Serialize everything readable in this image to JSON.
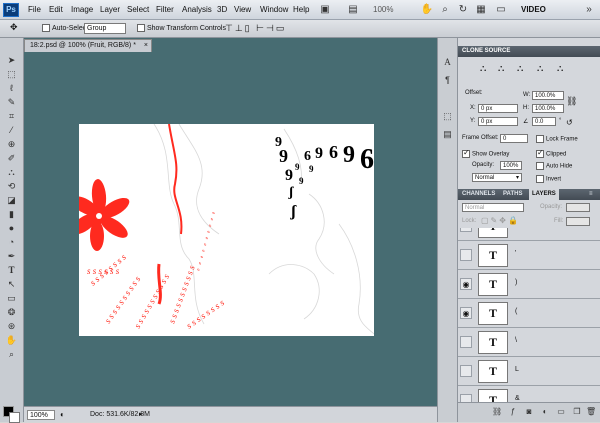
{
  "app": {
    "logo": "Ps"
  },
  "menu": [
    "File",
    "Edit",
    "Image",
    "Layer",
    "Select",
    "Filter",
    "Analysis",
    "3D",
    "View",
    "Window",
    "Help"
  ],
  "menubar_right": {
    "zoom": "100%",
    "workspace": "VIDEO"
  },
  "options": {
    "auto_select_label": "Auto-Select:",
    "auto_select_value": "Group",
    "show_transform_label": "Show Transform Controls"
  },
  "document": {
    "tab_title": "18:2.psd @ 100% (Fruit, RGB/8) *",
    "zoom": "100%",
    "doc_size": "Doc: 531.6K/82.8M"
  },
  "clone_source": {
    "title": "CLONE SOURCE",
    "offset_label": "Offset:",
    "x_label": "X:",
    "x_value": "0 px",
    "y_label": "Y:",
    "y_value": "0 px",
    "w_label": "W:",
    "w_value": "100.0%",
    "h_label": "H:",
    "h_value": "100.0%",
    "angle_value": "0.0",
    "frame_offset_label": "Frame Offset:",
    "frame_offset_value": "0",
    "lock_frame_label": "Lock Frame",
    "show_overlay_label": "Show Overlay",
    "opacity_label": "Opacity:",
    "opacity_value": "100%",
    "clipped_label": "Clipped",
    "auto_hide_label": "Auto Hide",
    "blend_value": "Normal",
    "invert_label": "Invert"
  },
  "layers_panel": {
    "tabs": [
      "CHANNELS",
      "PATHS",
      "LAYERS"
    ],
    "blend_mode": "Normal",
    "opacity_label": "Opacity:",
    "lock_label": "Lock:",
    "fill_label": "Fill:",
    "thumb_glyph": "T",
    "layers": [
      {
        "name": "",
        "visible": false
      },
      {
        "name": "'",
        "visible": false
      },
      {
        "name": ")",
        "visible": true
      },
      {
        "name": "(",
        "visible": true
      },
      {
        "name": "\\",
        "visible": false
      },
      {
        "name": "L",
        "visible": false
      },
      {
        "name": "&",
        "visible": false
      }
    ]
  },
  "colors": {
    "workspace": "#476c72",
    "flower": "#ff2a1f"
  }
}
